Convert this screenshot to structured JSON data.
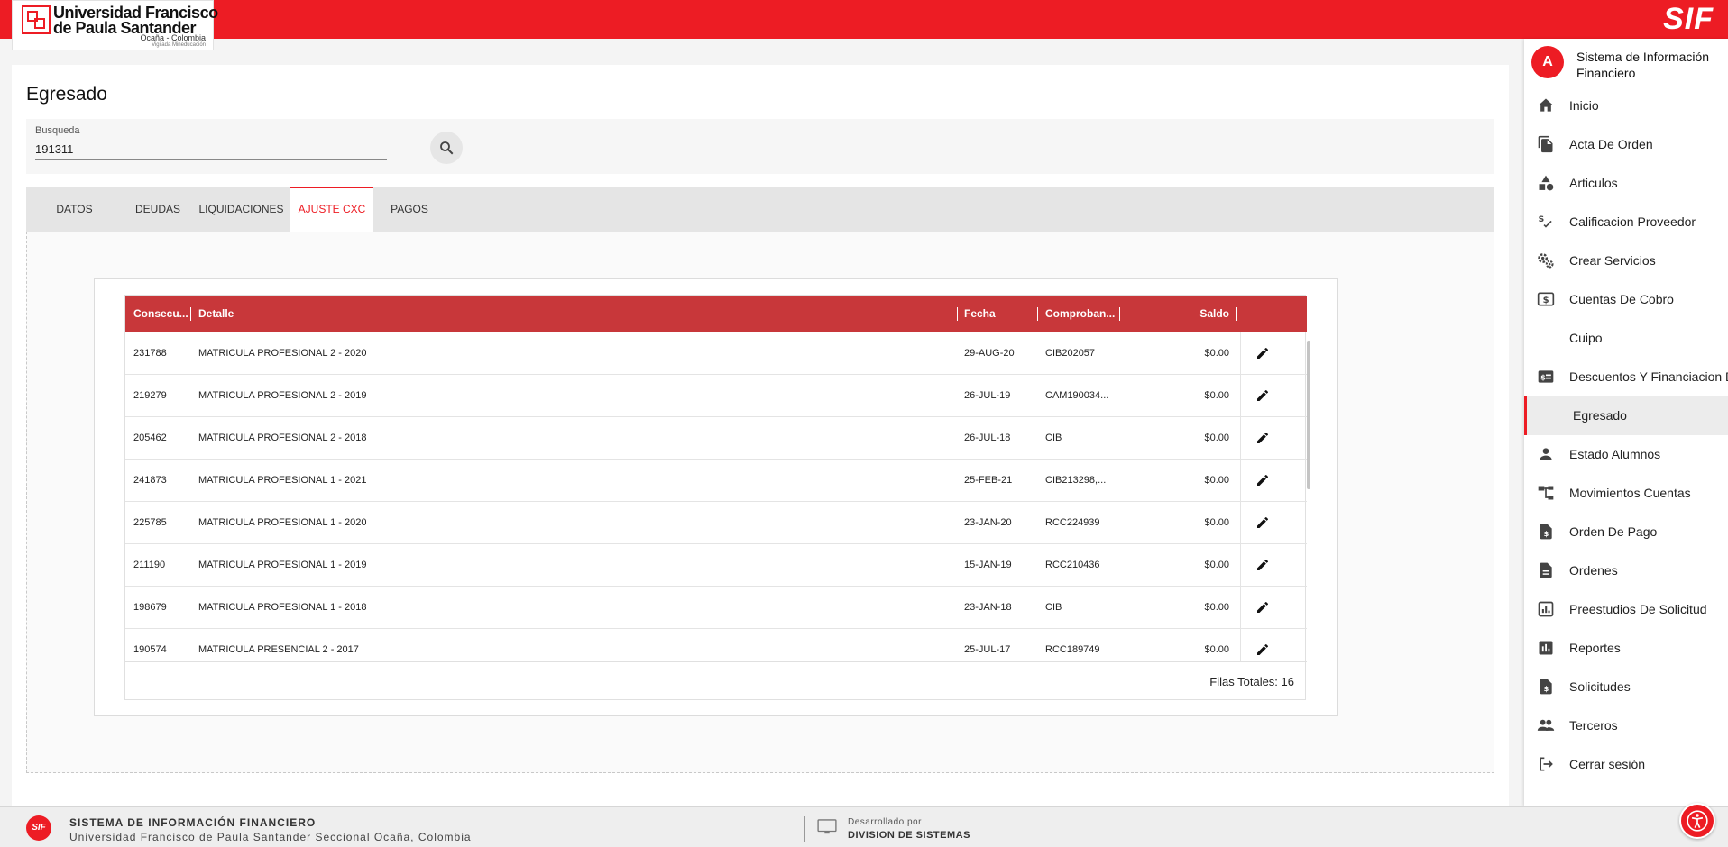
{
  "header": {
    "logo": {
      "line1": "Universidad Francisco",
      "line2": "de Paula Santander",
      "line3": "Ocaña - Colombia",
      "line4": "Vigilada Mineducación"
    },
    "brand": "SIF"
  },
  "page": {
    "title": "Egresado"
  },
  "search": {
    "label": "Busqueda",
    "value": "191311",
    "icon": "search-icon"
  },
  "tabs": [
    {
      "label": "DATOS",
      "active": false
    },
    {
      "label": "DEUDAS",
      "active": false
    },
    {
      "label": "LIQUIDACIONES",
      "active": false
    },
    {
      "label": "AJUSTE CXC",
      "active": true
    },
    {
      "label": "PAGOS",
      "active": false
    }
  ],
  "table": {
    "columns": [
      "Consecu...",
      "Detalle",
      "Fecha",
      "Comproban...",
      "Saldo"
    ],
    "rows": [
      {
        "consecutivo": "231788",
        "detalle": "MATRICULA PROFESIONAL 2 - 2020",
        "fecha": "29-AUG-20",
        "comprobante": "CIB202057",
        "saldo": "$0.00"
      },
      {
        "consecutivo": "219279",
        "detalle": "MATRICULA PROFESIONAL 2 - 2019",
        "fecha": "26-JUL-19",
        "comprobante": "CAM190034...",
        "saldo": "$0.00"
      },
      {
        "consecutivo": "205462",
        "detalle": "MATRICULA PROFESIONAL 2 - 2018",
        "fecha": "26-JUL-18",
        "comprobante": "CIB",
        "saldo": "$0.00"
      },
      {
        "consecutivo": "241873",
        "detalle": "MATRICULA PROFESIONAL 1 - 2021",
        "fecha": "25-FEB-21",
        "comprobante": "CIB213298,...",
        "saldo": "$0.00"
      },
      {
        "consecutivo": "225785",
        "detalle": "MATRICULA PROFESIONAL 1 - 2020",
        "fecha": "23-JAN-20",
        "comprobante": "RCC224939",
        "saldo": "$0.00"
      },
      {
        "consecutivo": "211190",
        "detalle": "MATRICULA PROFESIONAL 1 - 2019",
        "fecha": "15-JAN-19",
        "comprobante": "RCC210436",
        "saldo": "$0.00"
      },
      {
        "consecutivo": "198679",
        "detalle": "MATRICULA PROFESIONAL 1 - 2018",
        "fecha": "23-JAN-18",
        "comprobante": "CIB",
        "saldo": "$0.00"
      },
      {
        "consecutivo": "190574",
        "detalle": "MATRICULA PRESENCIAL 2 - 2017",
        "fecha": "25-JUL-17",
        "comprobante": "RCC189749",
        "saldo": "$0.00"
      }
    ],
    "total_label": "Filas Totales: 16",
    "row_action_icon": "pencil-edit-icon"
  },
  "sidebar": {
    "avatar_letter": "A",
    "title": "Sistema de Información Financiero",
    "items": [
      {
        "label": "Inicio",
        "icon": "home-icon",
        "active": false
      },
      {
        "label": "Acta De Orden",
        "icon": "documents-icon",
        "active": false
      },
      {
        "label": "Articulos",
        "icon": "shapes-icon",
        "active": false
      },
      {
        "label": "Calificacion Proveedor",
        "icon": "grade-check-icon",
        "active": false
      },
      {
        "label": "Crear Servicios",
        "icon": "gears-icon",
        "active": false
      },
      {
        "label": "Cuentas De Cobro",
        "icon": "money-icon",
        "active": false
      },
      {
        "label": "Cuipo",
        "icon": "",
        "active": false
      },
      {
        "label": "Descuentos Y Financiacion De Matricula",
        "icon": "discount-icon",
        "active": false
      },
      {
        "label": "Egresado",
        "icon": "",
        "active": true
      },
      {
        "label": "Estado Alumnos",
        "icon": "person-icon",
        "active": false
      },
      {
        "label": "Movimientos Cuentas",
        "icon": "account-tree-icon",
        "active": false
      },
      {
        "label": "Orden De Pago",
        "icon": "paid-document-icon",
        "active": false
      },
      {
        "label": "Ordenes",
        "icon": "document-icon",
        "active": false
      },
      {
        "label": "Preestudios De Solicitud",
        "icon": "chart-document-icon",
        "active": false
      },
      {
        "label": "Reportes",
        "icon": "bar-chart-icon",
        "active": false
      },
      {
        "label": "Solicitudes",
        "icon": "request-document-icon",
        "active": false
      },
      {
        "label": "Terceros",
        "icon": "people-icon",
        "active": false
      },
      {
        "label": "Cerrar sesión",
        "icon": "logout-icon",
        "active": false
      }
    ]
  },
  "footer": {
    "system_name": "SISTEMA DE INFORMACIÓN FINANCIERO",
    "university": "Universidad Francisco de Paula Santander Seccional Ocaña, Colombia",
    "developed_by": "Desarrollado por",
    "division": "DIVISION DE SISTEMAS",
    "logo_text": "SIF"
  },
  "colors": {
    "primary": "#ed1c24",
    "table_header": "#c8373a"
  }
}
